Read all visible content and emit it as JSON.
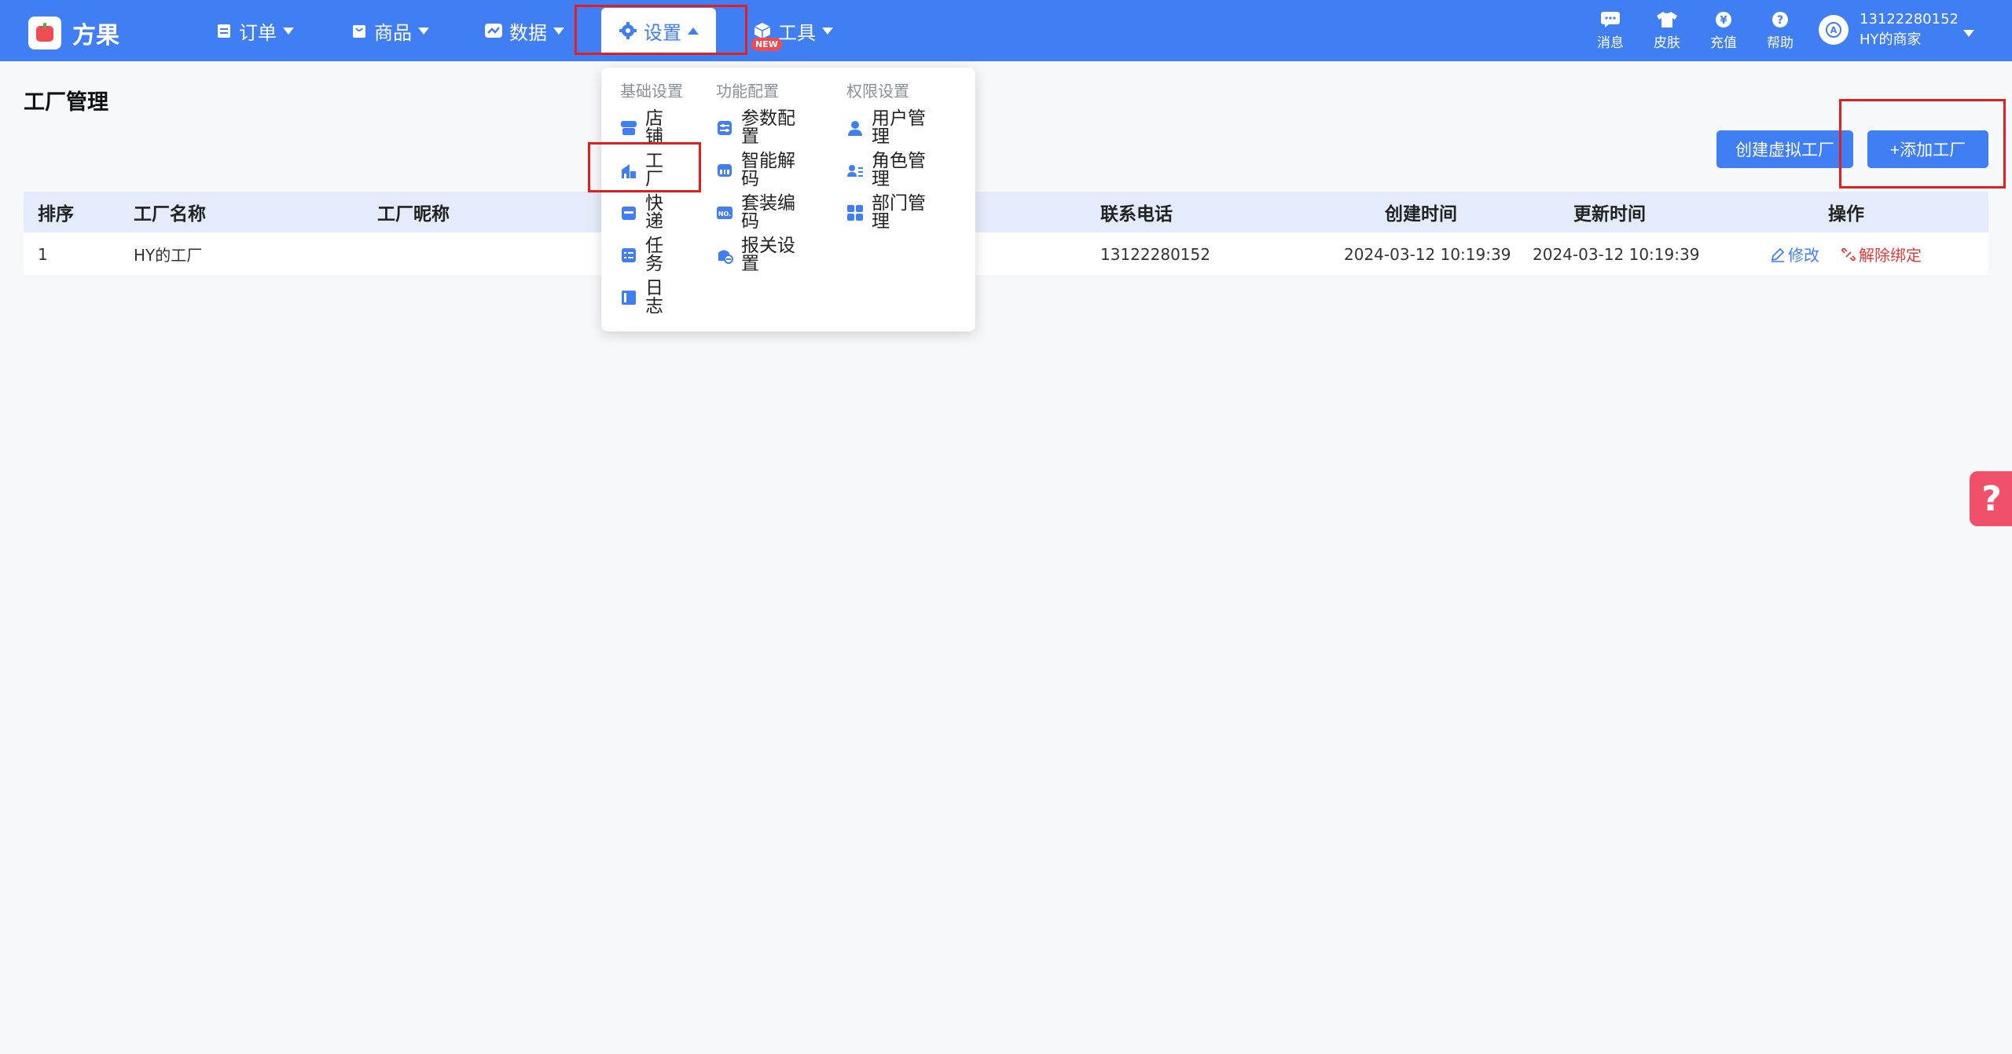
{
  "app": {
    "name": "方果"
  },
  "nav": {
    "order": "订单",
    "goods": "商品",
    "data": "数据",
    "settings": "设置",
    "tools": "工具",
    "tools_badge": "NEW"
  },
  "toolbar": {
    "messages": "消息",
    "skin": "皮肤",
    "recharge": "充值",
    "help": "帮助"
  },
  "account": {
    "phone": "13122280152",
    "merchant": "HY的商家"
  },
  "page": {
    "title": "工厂管理",
    "create_virtual_button": "创建虚拟工厂",
    "add_factory_button": "+添加工厂"
  },
  "table": {
    "headers": [
      "排序",
      "工厂名称",
      "工厂昵称",
      "联系电话",
      "创建时间",
      "更新时间",
      "操作"
    ],
    "rows": [
      {
        "order": "1",
        "name": "HY的工厂",
        "nickname": "",
        "phone": "13122280152",
        "created": "2024-03-12 10:19:39",
        "updated": "2024-03-12 10:19:39",
        "edit": "修改",
        "unbind": "解除绑定"
      }
    ]
  },
  "dropdown": {
    "col1_title": "基础设置",
    "col2_title": "功能配置",
    "col3_title": "权限设置",
    "col1": [
      "店铺",
      "工厂",
      "快递",
      "任务",
      "日志"
    ],
    "col2": [
      "参数配置",
      "智能解码",
      "套装编码",
      "报关设置"
    ],
    "col3": [
      "用户管理",
      "角色管理",
      "部门管理"
    ]
  },
  "colors": {
    "primary": "#3f7ef3",
    "annotation": "#e02020",
    "danger": "#e03b3b"
  }
}
